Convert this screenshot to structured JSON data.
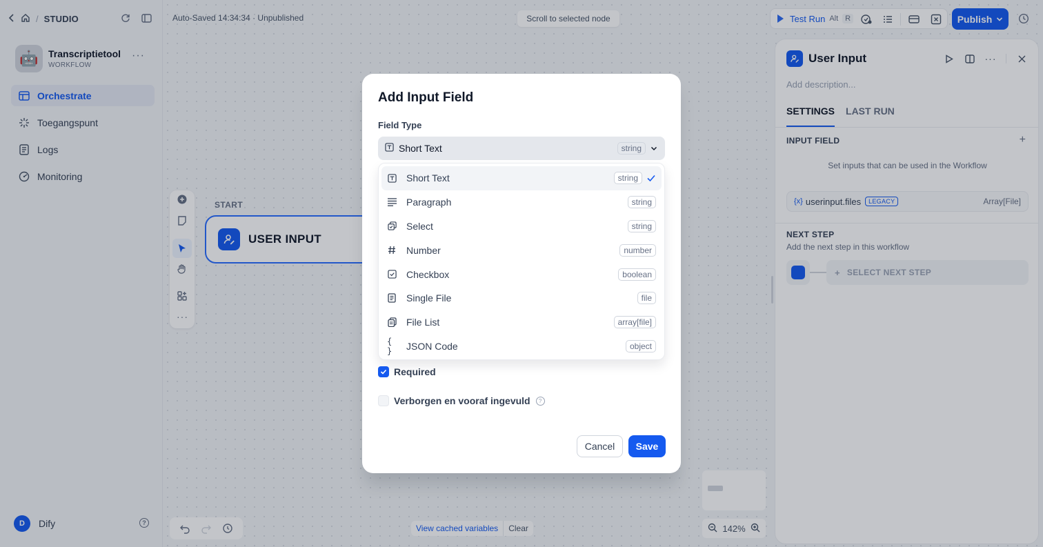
{
  "breadcrumb": {
    "section": "STUDIO"
  },
  "app": {
    "name": "Transcriptietool",
    "type": "WORKFLOW",
    "emoji": "🤖"
  },
  "nav": [
    {
      "label": "Orchestrate",
      "icon": "layout-icon",
      "active": true
    },
    {
      "label": "Toegangspunt",
      "icon": "access-point-icon",
      "active": false
    },
    {
      "label": "Logs",
      "icon": "logs-icon",
      "active": false
    },
    {
      "label": "Monitoring",
      "icon": "monitoring-icon",
      "active": false
    }
  ],
  "user": {
    "initial": "D",
    "name": "Dify"
  },
  "header": {
    "autosave": "Auto-Saved 14:34:34 · Unpublished",
    "scroll_to_node": "Scroll to selected node",
    "test_run": "Test Run",
    "test_run_key1": "Alt",
    "test_run_key2": "R",
    "publish": "Publish"
  },
  "canvas": {
    "start_label": "START",
    "node_title": "USER INPUT",
    "view_cached": "View cached variables",
    "clear": "Clear",
    "zoom": "142%"
  },
  "panel": {
    "title": "User Input",
    "description_placeholder": "Add description...",
    "tabs": [
      "SETTINGS",
      "LAST RUN"
    ],
    "input_field_title": "INPUT FIELD",
    "input_field_hint": "Set inputs that can be used in the Workflow",
    "variable": {
      "prefix": "{x}",
      "name": "userinput.files",
      "badge": "LEGACY",
      "type": "Array[File]"
    },
    "next_step_title": "NEXT STEP",
    "next_step_sub": "Add the next step in this workflow",
    "select_next": "SELECT NEXT STEP"
  },
  "modal": {
    "title": "Add Input Field",
    "field_type_label": "Field Type",
    "selected": {
      "label": "Short Text",
      "type": "string"
    },
    "options": [
      {
        "label": "Short Text",
        "type": "string",
        "icon": "text-input-icon",
        "selected": true
      },
      {
        "label": "Paragraph",
        "type": "string",
        "icon": "paragraph-icon",
        "selected": false
      },
      {
        "label": "Select",
        "type": "string",
        "icon": "select-icon",
        "selected": false
      },
      {
        "label": "Number",
        "type": "number",
        "icon": "hash-icon",
        "selected": false
      },
      {
        "label": "Checkbox",
        "type": "boolean",
        "icon": "checkbox-icon",
        "selected": false
      },
      {
        "label": "Single File",
        "type": "file",
        "icon": "file-icon",
        "selected": false
      },
      {
        "label": "File List",
        "type": "array[file]",
        "icon": "file-list-icon",
        "selected": false
      },
      {
        "label": "JSON Code",
        "type": "object",
        "icon": "braces-icon",
        "selected": false
      }
    ],
    "required_label": "Required",
    "required_checked": true,
    "hidden_label": "Verborgen en vooraf ingevuld",
    "hidden_checked": false,
    "cancel": "Cancel",
    "save": "Save"
  },
  "colors": {
    "accent": "#155aef",
    "text": "#101828",
    "muted": "#667085"
  }
}
